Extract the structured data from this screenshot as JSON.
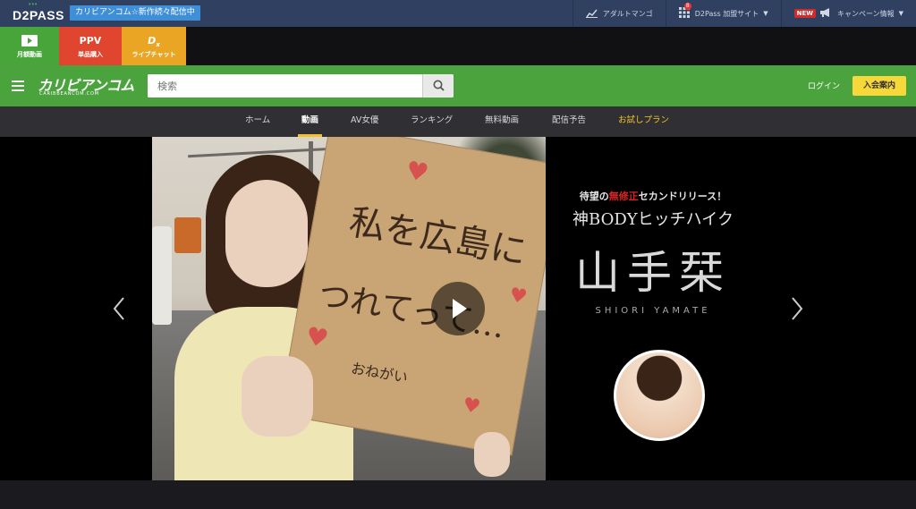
{
  "topbar": {
    "logo": "D2PASS",
    "announce": "カリビアンコム☆新作続々配信中",
    "items": [
      {
        "label": "アダルトマンゴ",
        "icon": "chart-icon"
      },
      {
        "label": "D2Pass 加盟サイト",
        "icon": "grid-icon",
        "badge": "8"
      },
      {
        "label": "キャンペーン情報",
        "icon": "megaphone-icon",
        "tag": "NEW"
      }
    ]
  },
  "services": [
    {
      "big": "▶",
      "small": "月額動画",
      "color": "#47a53a"
    },
    {
      "big": "PPV",
      "small": "単品購入",
      "color": "#e0452f"
    },
    {
      "big": "D",
      "small": "ライブチャット",
      "color": "#eaa525"
    }
  ],
  "header": {
    "brand": "カリビアンコム",
    "brand_sub": "CARIBBEANCOM.COM",
    "search_placeholder": "検索",
    "login": "ログイン",
    "join": "入会案内"
  },
  "nav": [
    {
      "label": "ホーム"
    },
    {
      "label": "動画"
    },
    {
      "label": "AV女優"
    },
    {
      "label": "ランキング"
    },
    {
      "label": "無料動画"
    },
    {
      "label": "配信予告"
    },
    {
      "label": "お試しプラン"
    }
  ],
  "hero": {
    "tag_prefix": "待望の",
    "tag_red": "無修正",
    "tag_suffix": "セカンドリリース！",
    "subtitle": "神BODYヒッチハイク",
    "name": "山手栞",
    "roma": "SHIORI YAMATE",
    "sign_line1": "私を広島に",
    "sign_line2": "つれてって…",
    "sign_line3": "おねがい"
  }
}
